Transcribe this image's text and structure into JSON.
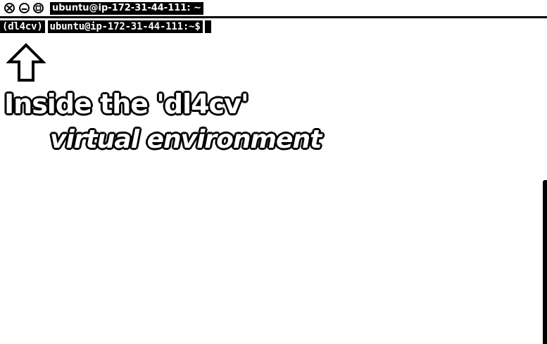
{
  "window": {
    "title": "ubuntu@ip-172-31-44-111: ~",
    "buttons": {
      "close_icon": "close-icon",
      "minimize_icon": "minimize-icon",
      "maximize_icon": "maximize-icon"
    }
  },
  "terminal": {
    "env": "(dl4cv)",
    "prompt": "ubuntu@ip-172-31-44-111:~$",
    "input": ""
  },
  "annotation": {
    "arrow_icon": "up-arrow-icon",
    "line1": "Inside the 'dl4cv'",
    "line2": "virtual environment"
  },
  "colors": {
    "background": "#ffffff",
    "foreground": "#000000"
  }
}
